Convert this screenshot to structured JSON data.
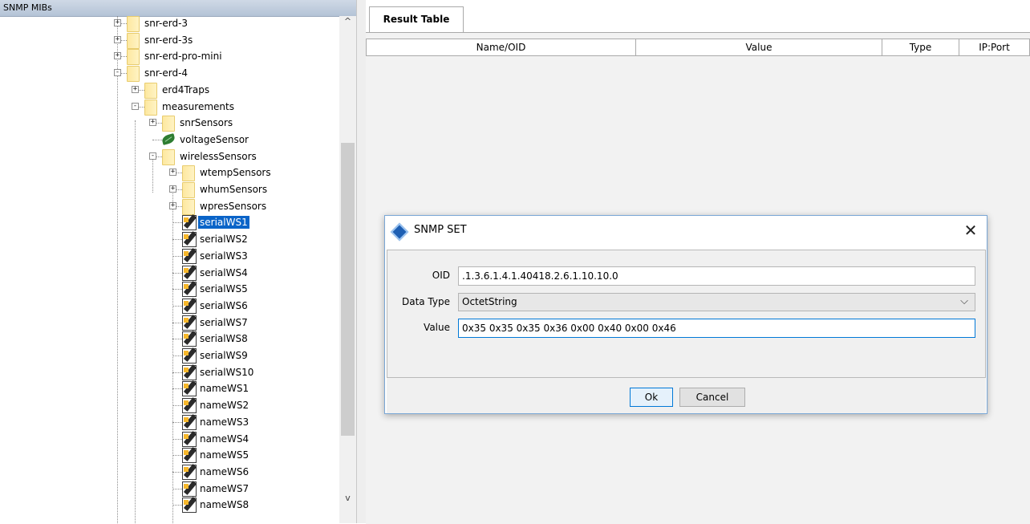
{
  "left_panel": {
    "title": "SNMP MIBs"
  },
  "tree": {
    "nodes": [
      {
        "label": "snr-erd-3",
        "kind": "folder",
        "level": 0,
        "expander": "+"
      },
      {
        "label": "snr-erd-3s",
        "kind": "folder",
        "level": 0,
        "expander": "+"
      },
      {
        "label": "snr-erd-pro-mini",
        "kind": "folder",
        "level": 0,
        "expander": "+"
      },
      {
        "label": "snr-erd-4",
        "kind": "folder",
        "level": 0,
        "expander": "-"
      },
      {
        "label": "erd4Traps",
        "kind": "folder",
        "level": 1,
        "expander": "+"
      },
      {
        "label": "measurements",
        "kind": "folder",
        "level": 1,
        "expander": "-"
      },
      {
        "label": "snrSensors",
        "kind": "folder",
        "level": 2,
        "expander": "+"
      },
      {
        "label": "voltageSensor",
        "kind": "leaf",
        "level": 2,
        "expander": ""
      },
      {
        "label": "wirelessSensors",
        "kind": "folder",
        "level": 2,
        "expander": "-"
      },
      {
        "label": "wtempSensors",
        "kind": "folder",
        "level": 3,
        "expander": "+"
      },
      {
        "label": "whumSensors",
        "kind": "folder",
        "level": 3,
        "expander": "+"
      },
      {
        "label": "wpresSensors",
        "kind": "folder",
        "level": 3,
        "expander": "+"
      },
      {
        "label": "serialWS1",
        "kind": "writable",
        "level": 3,
        "expander": "",
        "selected": true
      },
      {
        "label": "serialWS2",
        "kind": "writable",
        "level": 3,
        "expander": ""
      },
      {
        "label": "serialWS3",
        "kind": "writable",
        "level": 3,
        "expander": ""
      },
      {
        "label": "serialWS4",
        "kind": "writable",
        "level": 3,
        "expander": ""
      },
      {
        "label": "serialWS5",
        "kind": "writable",
        "level": 3,
        "expander": ""
      },
      {
        "label": "serialWS6",
        "kind": "writable",
        "level": 3,
        "expander": ""
      },
      {
        "label": "serialWS7",
        "kind": "writable",
        "level": 3,
        "expander": ""
      },
      {
        "label": "serialWS8",
        "kind": "writable",
        "level": 3,
        "expander": ""
      },
      {
        "label": "serialWS9",
        "kind": "writable",
        "level": 3,
        "expander": ""
      },
      {
        "label": "serialWS10",
        "kind": "writable",
        "level": 3,
        "expander": ""
      },
      {
        "label": "nameWS1",
        "kind": "writable",
        "level": 3,
        "expander": ""
      },
      {
        "label": "nameWS2",
        "kind": "writable",
        "level": 3,
        "expander": ""
      },
      {
        "label": "nameWS3",
        "kind": "writable",
        "level": 3,
        "expander": ""
      },
      {
        "label": "nameWS4",
        "kind": "writable",
        "level": 3,
        "expander": ""
      },
      {
        "label": "nameWS5",
        "kind": "writable",
        "level": 3,
        "expander": ""
      },
      {
        "label": "nameWS6",
        "kind": "writable",
        "level": 3,
        "expander": ""
      },
      {
        "label": "nameWS7",
        "kind": "writable",
        "level": 3,
        "expander": ""
      },
      {
        "label": "nameWS8",
        "kind": "writable",
        "level": 3,
        "expander": ""
      }
    ]
  },
  "scrollbar": {
    "up_glyph": "^",
    "down_glyph": "v"
  },
  "result_panel": {
    "tab_label": "Result Table",
    "columns": [
      "Name/OID",
      "Value",
      "Type",
      "IP:Port"
    ]
  },
  "dialog": {
    "title": "SNMP SET",
    "close_glyph": "✕",
    "oid_label": "OID",
    "oid_value": ".1.3.6.1.4.1.40418.2.6.1.10.10.0",
    "data_type_label": "Data Type",
    "data_type_value": "OctetString",
    "data_type_chevron": "⌵",
    "value_label": "Value",
    "value_value": "0x35 0x35 0x35 0x36 0x00 0x40 0x00 0x46",
    "ok_label": "Ok",
    "cancel_label": "Cancel"
  },
  "colors": {
    "selection": "#0a64c8",
    "dialog_border": "#7aa7d6",
    "ok_border": "#0078d7"
  }
}
